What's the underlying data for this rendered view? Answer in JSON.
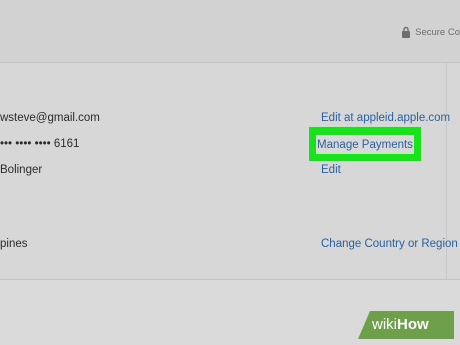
{
  "header": {
    "secure_label": "Secure Co",
    "lock_icon": "lock-icon"
  },
  "account": {
    "email": "wsteve@gmail.com",
    "email_link": "Edit at appleid.apple.com",
    "card": "••• •••• •••• 6161",
    "card_link": "Manage Payments",
    "name": "Bolinger",
    "name_link": "Edit",
    "country": "pines",
    "country_link": "Change Country or Region"
  },
  "colors": {
    "highlight": "#16e31a",
    "link": "#2b5f9e"
  },
  "watermark": {
    "prefix": "wiki",
    "suffix": "How"
  }
}
